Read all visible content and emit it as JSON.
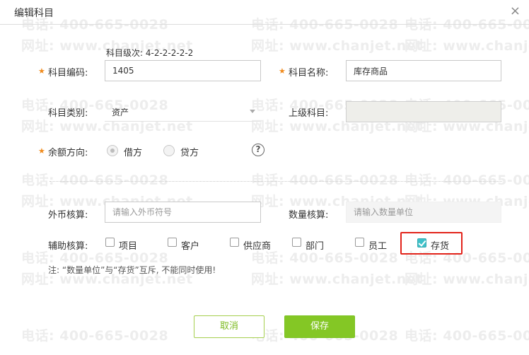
{
  "dialog": {
    "title": "编辑科目",
    "close_symbol": "×"
  },
  "watermark": {
    "phone": "电话: 400-665-0028",
    "website": "网址: www.chanjet.net"
  },
  "form": {
    "code": {
      "level_hint": "科目级次: 4-2-2-2-2-2",
      "label": "科目编码:",
      "value": "1405"
    },
    "name": {
      "label": "科目名称:",
      "value": "库存商品"
    },
    "category": {
      "label": "科目类别:",
      "value": "资产"
    },
    "parent": {
      "label": "上级科目:",
      "value": ""
    },
    "direction": {
      "label": "余额方向:",
      "options": [
        "借方",
        "贷方"
      ],
      "selected": "借方",
      "help_symbol": "?"
    },
    "currency": {
      "label": "外币核算:",
      "placeholder": "请输入外币符号"
    },
    "quantity": {
      "label": "数量核算:",
      "placeholder": "请输入数量单位"
    },
    "auxiliary": {
      "label": "辅助核算:",
      "items": [
        {
          "label": "项目",
          "checked": false
        },
        {
          "label": "客户",
          "checked": false
        },
        {
          "label": "供应商",
          "checked": false
        },
        {
          "label": "部门",
          "checked": false
        },
        {
          "label": "员工",
          "checked": false
        },
        {
          "label": "存货",
          "checked": true
        }
      ]
    },
    "note": "注: “数量单位”与“存货”互斥, 不能同时使用!"
  },
  "buttons": {
    "cancel": "取消",
    "save": "保存"
  },
  "colors": {
    "required_star": "#f08a1c",
    "save_green": "#84c725",
    "highlight_red": "#e2231a",
    "checkbox_teal": "#3fc1c9"
  }
}
